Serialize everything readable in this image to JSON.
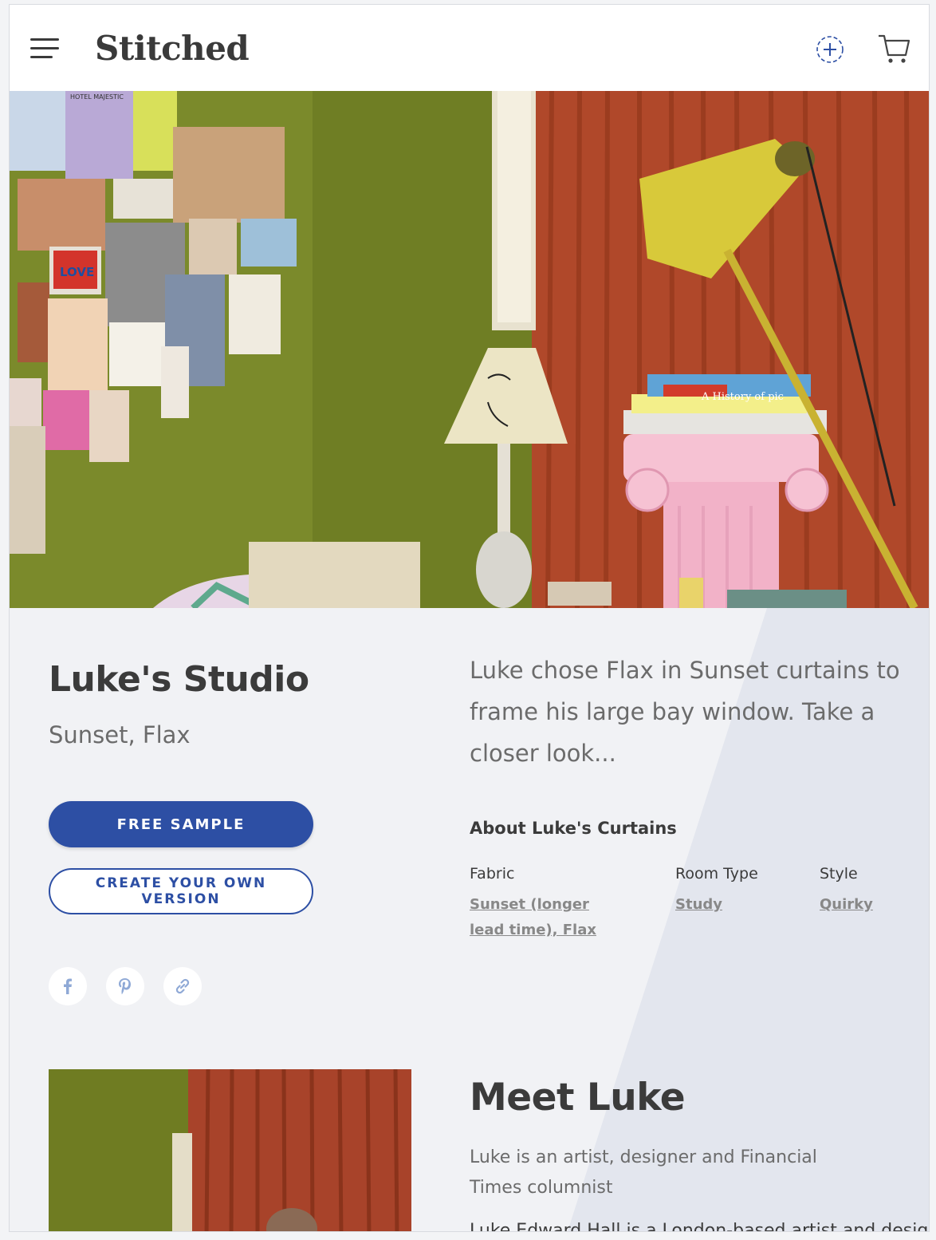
{
  "header": {
    "logo": "Stitched",
    "menu_icon": "hamburger-menu-icon",
    "add_icon": "add-circle-icon",
    "cart_icon": "shopping-cart-icon"
  },
  "hero": {
    "image": "studio-interior-photo",
    "book_title": "A History of pic",
    "poster_text": "HOTEL MAJESTIC",
    "love_text": "LOVE"
  },
  "project": {
    "title": "Luke's Studio",
    "subtitle": "Sunset, Flax",
    "free_sample_label": "FREE SAMPLE",
    "create_version_label": "CREATE YOUR OWN VERSION",
    "intro": "Luke chose Flax in Sunset curtains to frame his large bay window. Take a closer look..."
  },
  "social": [
    {
      "name": "facebook-icon"
    },
    {
      "name": "pinterest-icon"
    },
    {
      "name": "link-icon"
    }
  ],
  "about": {
    "title": "About Luke's Curtains",
    "fabric_label": "Fabric",
    "fabric_line1": "Sunset (longer",
    "fabric_line2": "lead time), Flax",
    "room_label": "Room Type",
    "room_value": "Study",
    "style_label": "Style",
    "style_value": "Quirky"
  },
  "meet": {
    "title": "Meet Luke",
    "description": "Luke is an artist, designer and Financial Times columnist",
    "more": "Luke Edward Hall is a London-based artist and designer"
  },
  "colors": {
    "primary": "#2d4fa4",
    "background": "#f1f2f5",
    "accent_panel": "#e3e6ee",
    "wall_green": "#7a8a2a",
    "curtain_rust": "#b04a26"
  }
}
